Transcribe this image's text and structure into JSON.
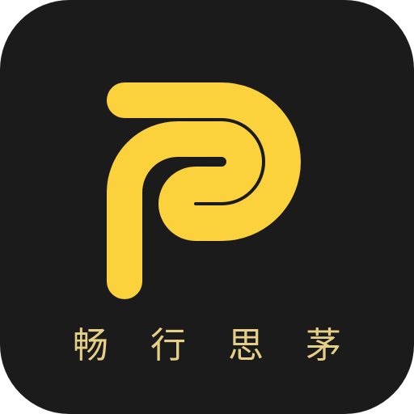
{
  "app_icon": {
    "name": "畅行思茅",
    "logo_icon": "p-letter-logo-icon",
    "background_color": "#1b1b1b",
    "logo_color": "#fcd23c",
    "text_color": "#e6cf86"
  }
}
